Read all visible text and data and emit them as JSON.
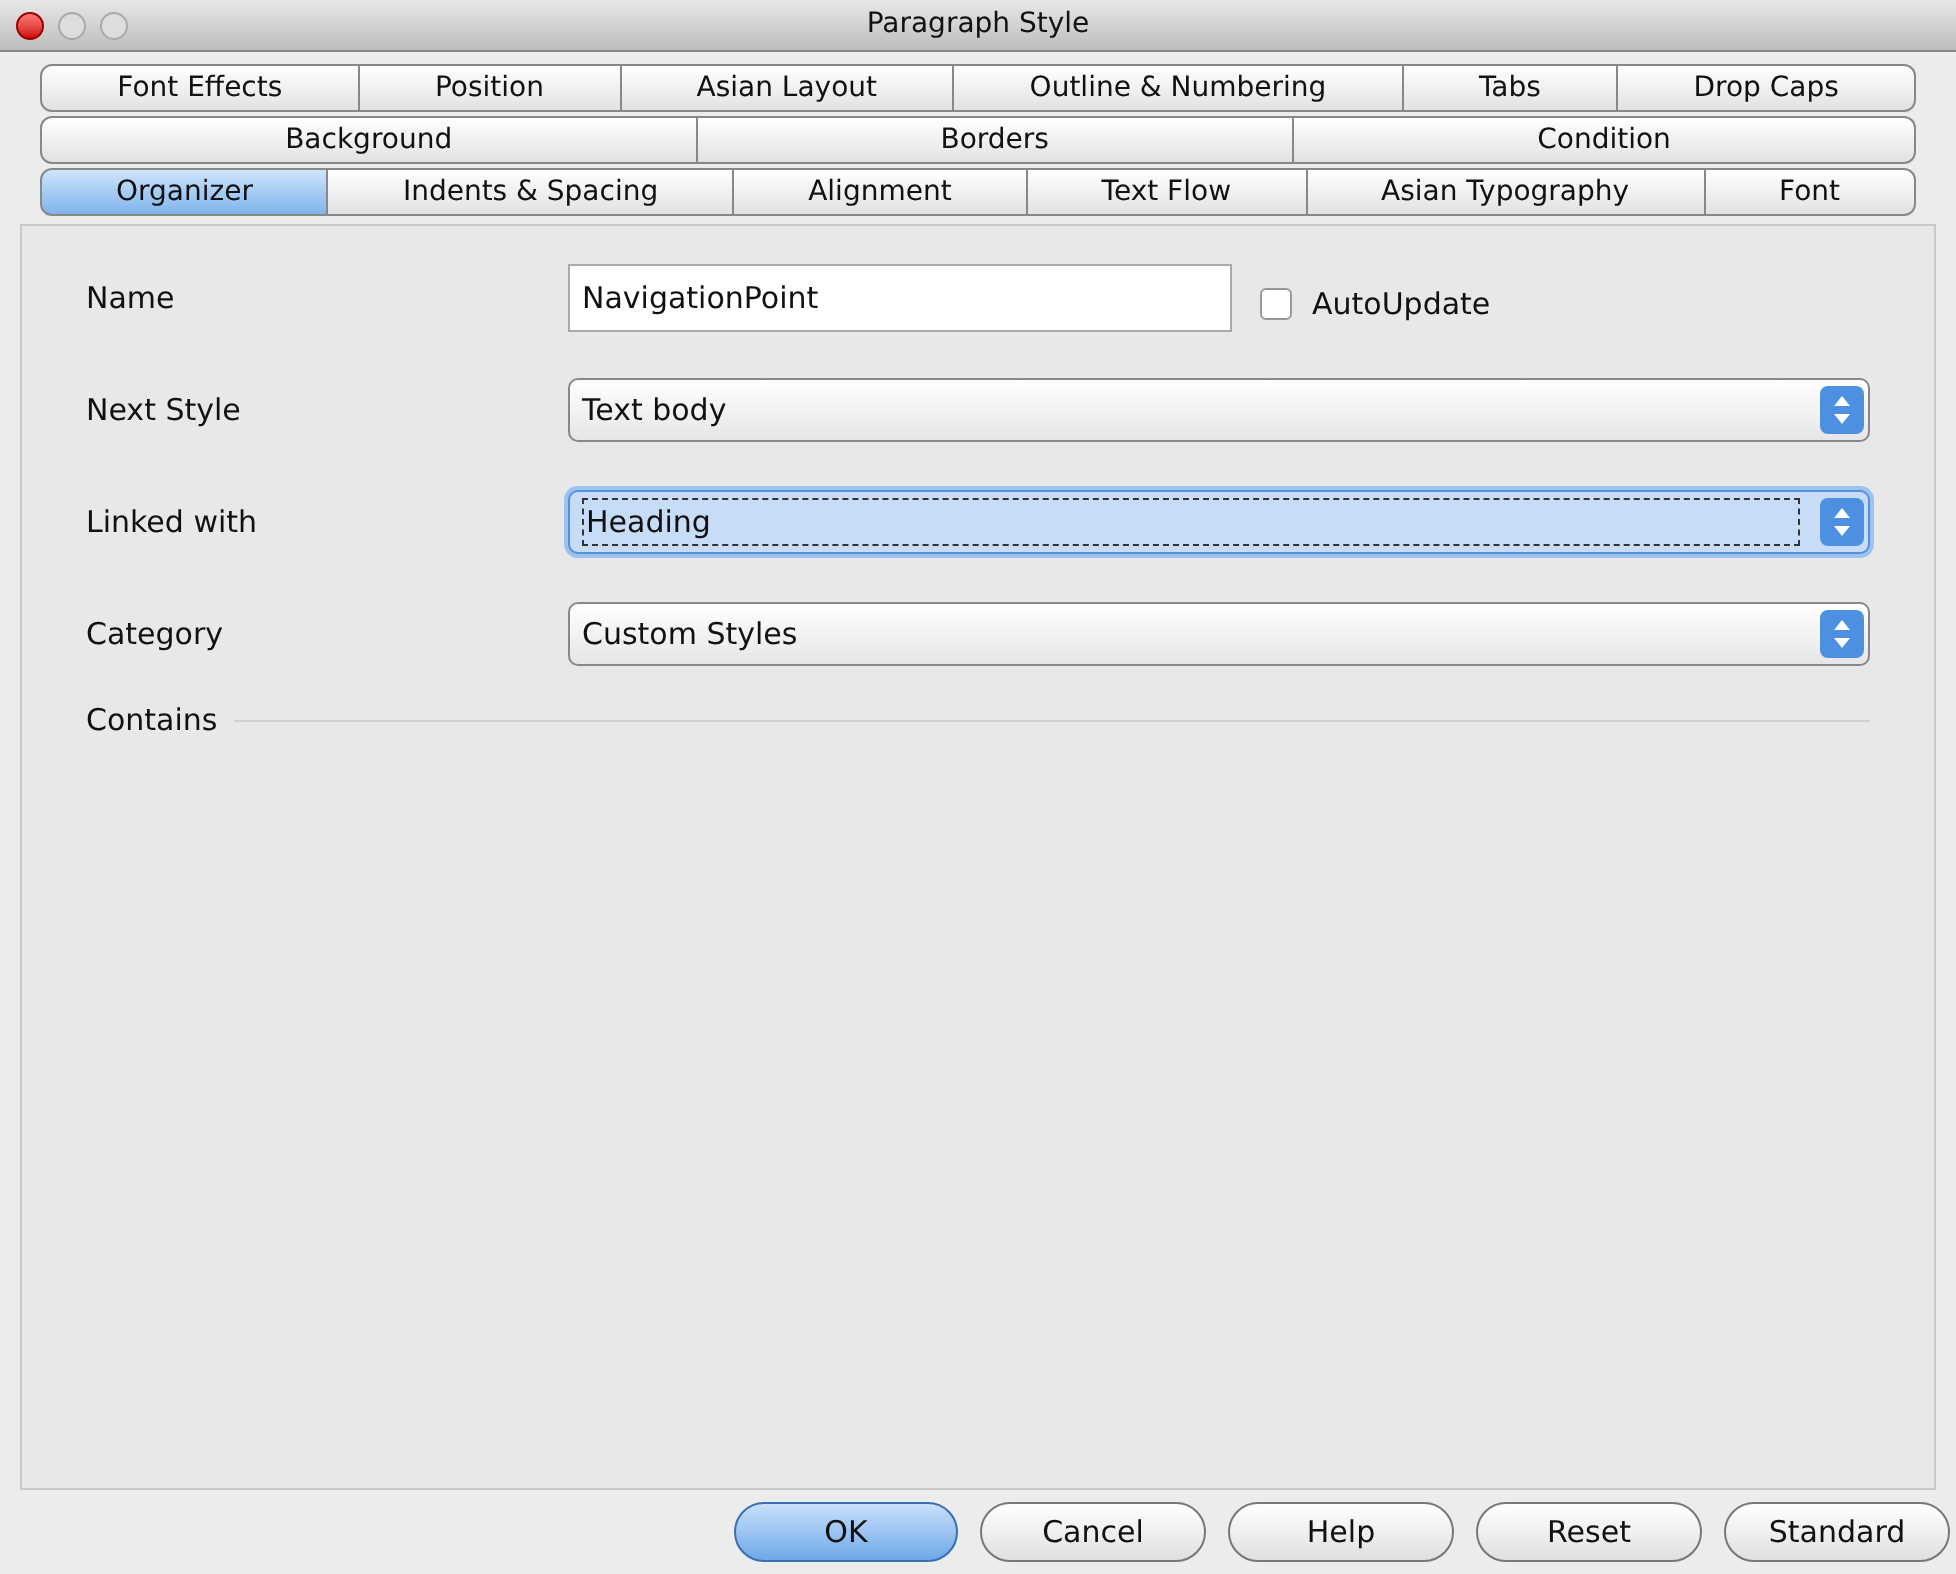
{
  "window": {
    "title": "Paragraph Style"
  },
  "tab_rows": [
    [
      {
        "label": "Font Effects",
        "selected": false
      },
      {
        "label": "Position",
        "selected": false
      },
      {
        "label": "Asian Layout",
        "selected": false
      },
      {
        "label": "Outline & Numbering",
        "selected": false
      },
      {
        "label": "Tabs",
        "selected": false
      },
      {
        "label": "Drop Caps",
        "selected": false
      }
    ],
    [
      {
        "label": "Background",
        "selected": false
      },
      {
        "label": "Borders",
        "selected": false
      },
      {
        "label": "Condition",
        "selected": false
      }
    ],
    [
      {
        "label": "Organizer",
        "selected": true
      },
      {
        "label": "Indents & Spacing",
        "selected": false
      },
      {
        "label": "Alignment",
        "selected": false
      },
      {
        "label": "Text Flow",
        "selected": false
      },
      {
        "label": "Asian Typography",
        "selected": false
      },
      {
        "label": "Font",
        "selected": false
      }
    ]
  ],
  "name": {
    "label": "Name",
    "value": "NavigationPoint"
  },
  "autoupdate": {
    "label": "AutoUpdate",
    "checked": false
  },
  "dropdowns": [
    {
      "label": "Next Style",
      "value": "Text body",
      "focused": false
    },
    {
      "label": "Linked with",
      "value": "Heading",
      "focused": true
    },
    {
      "label": "Category",
      "value": "Custom Styles",
      "focused": false
    }
  ],
  "contains": {
    "label": "Contains"
  },
  "buttons": [
    {
      "label": "OK",
      "default": true
    },
    {
      "label": "Cancel",
      "default": false
    },
    {
      "label": "Help",
      "default": false
    },
    {
      "label": "Reset",
      "default": false
    },
    {
      "label": "Standard",
      "default": false
    }
  ]
}
